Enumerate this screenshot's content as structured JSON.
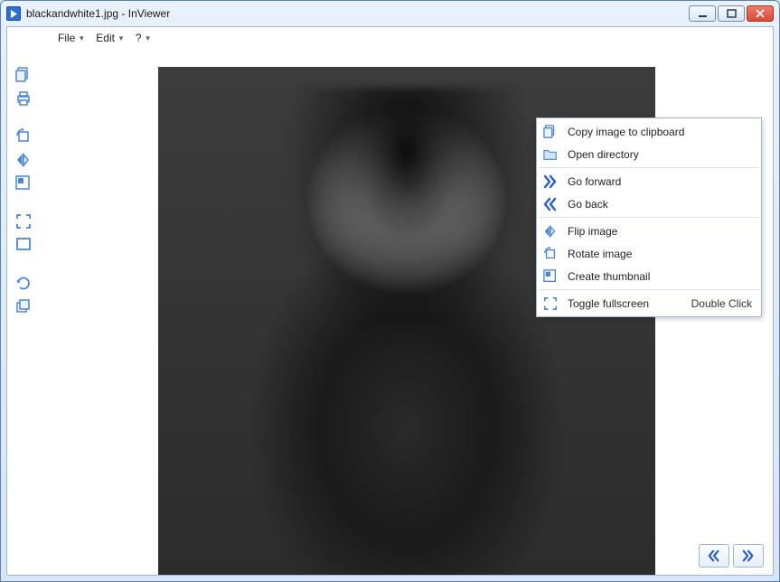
{
  "window": {
    "title": "blackandwhite1.jpg - InViewer"
  },
  "menubar": {
    "items": [
      {
        "label": "File"
      },
      {
        "label": "Edit"
      },
      {
        "label": "?"
      }
    ]
  },
  "toolbar": {
    "items": [
      {
        "name": "copy-icon"
      },
      {
        "name": "print-icon"
      },
      {
        "name": "spacer"
      },
      {
        "name": "rotate-icon"
      },
      {
        "name": "flip-icon"
      },
      {
        "name": "thumbnail-icon"
      },
      {
        "name": "spacer"
      },
      {
        "name": "fullscreen-icon"
      },
      {
        "name": "fit-icon"
      },
      {
        "name": "spacer"
      },
      {
        "name": "refresh-icon"
      },
      {
        "name": "stack-icon"
      }
    ]
  },
  "context_menu": {
    "groups": [
      [
        {
          "icon": "copy-icon",
          "label": "Copy image to clipboard",
          "shortcut": ""
        },
        {
          "icon": "folder-icon",
          "label": "Open directory",
          "shortcut": ""
        }
      ],
      [
        {
          "icon": "forward-icon",
          "label": "Go forward",
          "shortcut": ""
        },
        {
          "icon": "back-icon",
          "label": "Go back",
          "shortcut": ""
        }
      ],
      [
        {
          "icon": "flip-icon",
          "label": "Flip image",
          "shortcut": ""
        },
        {
          "icon": "rotate-icon",
          "label": "Rotate image",
          "shortcut": ""
        },
        {
          "icon": "thumbnail-icon",
          "label": "Create thumbnail",
          "shortcut": ""
        }
      ],
      [
        {
          "icon": "fullscreen-icon",
          "label": "Toggle fullscreen",
          "shortcut": "Double Click"
        }
      ]
    ]
  },
  "bottom_nav": {
    "prev_label": "Previous",
    "next_label": "Next"
  }
}
